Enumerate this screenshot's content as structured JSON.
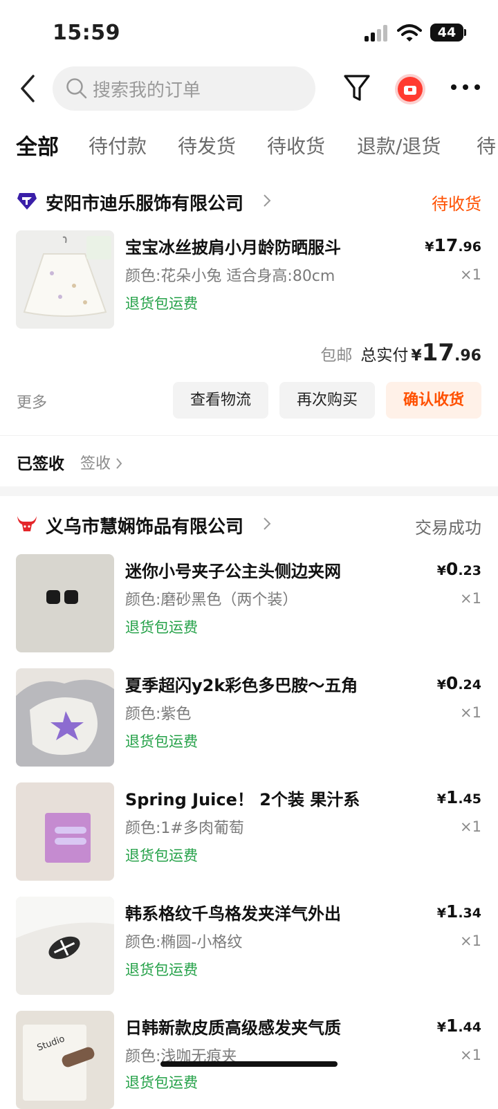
{
  "status_bar": {
    "time": "15:59",
    "battery": "44"
  },
  "header": {
    "search_placeholder": "搜索我的订单"
  },
  "tabs": [
    "全部",
    "待付款",
    "待发货",
    "待收货",
    "退款/退货",
    "待"
  ],
  "orders": [
    {
      "shop": "安阳市迪乐服饰有限公司",
      "status": "待收货",
      "items": [
        {
          "title": "宝宝冰丝披肩小月龄防晒服斗",
          "spec": "颜色:花朵小兔 适合身高:80cm",
          "return": "退货包运费",
          "price_symbol": "¥",
          "price_int": "17",
          "price_dec": ".96",
          "qty": "×1"
        }
      ],
      "shipping": "包邮",
      "total_label": "总实付",
      "total_symbol": "¥",
      "total_int": "17",
      "total_dec": ".96",
      "more": "更多",
      "buttons": [
        "查看物流",
        "再次购买",
        "确认收货"
      ],
      "delivery_state": "已签收",
      "delivery_detail": "签收"
    },
    {
      "shop": "义乌市慧娴饰品有限公司",
      "status": "交易成功",
      "items": [
        {
          "title": "迷你小号夹子公主头侧边夹网",
          "spec": "颜色:磨砂黑色（两个装）",
          "return": "退货包运费",
          "price_symbol": "¥",
          "price_int": "0",
          "price_dec": ".23",
          "qty": "×1"
        },
        {
          "title": "夏季超闪y2k彩色多巴胺～五角",
          "spec": "颜色:紫色",
          "return": "退货包运费",
          "price_symbol": "¥",
          "price_int": "0",
          "price_dec": ".24",
          "qty": "×1"
        },
        {
          "title": "Spring Juice！ 2个装 果汁系",
          "spec": "颜色:1#多肉葡萄",
          "return": "退货包运费",
          "price_symbol": "¥",
          "price_int": "1",
          "price_dec": ".45",
          "qty": "×1"
        },
        {
          "title": "韩系格纹千鸟格发夹洋气外出",
          "spec": "颜色:椭圆-小格纹",
          "return": "退货包运费",
          "price_symbol": "¥",
          "price_int": "1",
          "price_dec": ".34",
          "qty": "×1"
        },
        {
          "title": "日韩新款皮质高级感发夹气质",
          "spec": "颜色:浅咖无痕夹",
          "return": "退货包运费",
          "price_symbol": "¥",
          "price_int": "1",
          "price_dec": ".44",
          "qty": "×1",
          "thumb_text": "Studio"
        }
      ]
    }
  ],
  "colors": {
    "accent": "#ff5000",
    "accent_bg": "#fff1e8",
    "return_green": "#24a148",
    "shop1_logo": "#3a1fa8",
    "shop2_logo": "#e4262a"
  }
}
